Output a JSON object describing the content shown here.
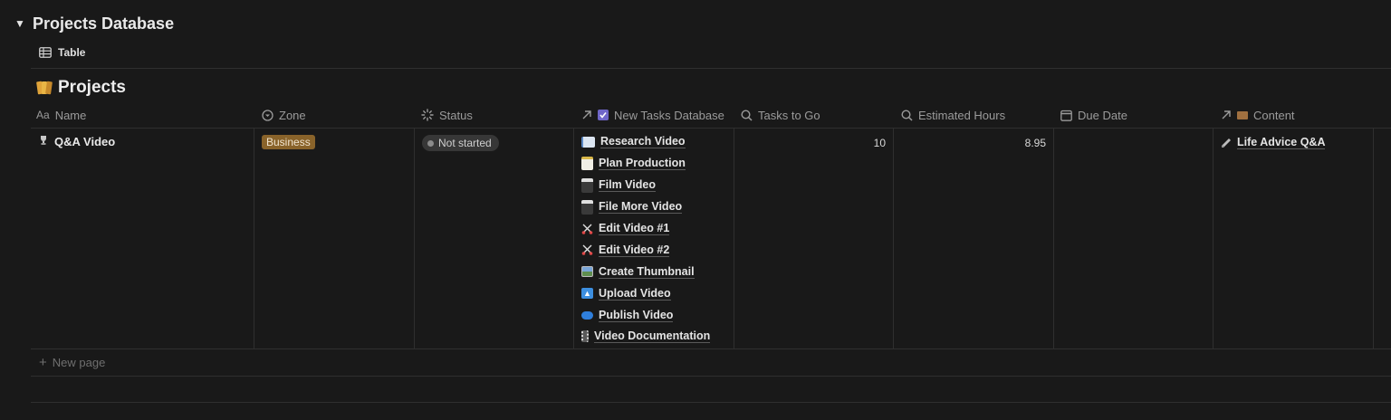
{
  "database": {
    "title": "Projects Database",
    "toggle_icon": "triangle-down-icon"
  },
  "view": {
    "label": "Table",
    "icon": "table-icon"
  },
  "projects_title": {
    "label": "Projects",
    "icon": "books-icon"
  },
  "columns": [
    {
      "label": "Name",
      "icon": "text-aa-icon"
    },
    {
      "label": "Zone",
      "icon": "select-icon"
    },
    {
      "label": "Status",
      "icon": "status-icon"
    },
    {
      "label": "New Tasks Database",
      "icon": "relation-arrow-icon"
    },
    {
      "label": "Tasks to Go",
      "icon": "search-icon"
    },
    {
      "label": "Estimated Hours",
      "icon": "search-icon"
    },
    {
      "label": "Due Date",
      "icon": "calendar-icon"
    },
    {
      "label": "Content",
      "icon": "relation-arrow-icon"
    }
  ],
  "row": {
    "name": "Q&A Video",
    "zone": "Business",
    "status": "Not started",
    "tasks": [
      {
        "label": "Research Video",
        "icon": "book-icon"
      },
      {
        "label": "Plan Production",
        "icon": "memo-icon"
      },
      {
        "label": "Film Video",
        "icon": "clapper-icon"
      },
      {
        "label": "File More Video",
        "icon": "clapper-icon"
      },
      {
        "label": "Edit Video #1",
        "icon": "scissors-icon"
      },
      {
        "label": "Edit Video #2",
        "icon": "scissors-icon"
      },
      {
        "label": "Create Thumbnail",
        "icon": "picture-icon"
      },
      {
        "label": "Upload Video",
        "icon": "up-arrow-icon"
      },
      {
        "label": "Publish Video",
        "icon": "blue-circle-icon"
      },
      {
        "label": "Video Documentation",
        "icon": "film-strip-icon"
      }
    ],
    "tasks_to_go": "10",
    "estimated_hours": "8.95",
    "due_date": "",
    "content": "Life Advice Q&A"
  },
  "new_page": {
    "label": "New page",
    "icon": "plus-icon"
  },
  "colors": {
    "background": "#191919",
    "zone_business": "#89632a",
    "status_pill": "#373737",
    "border": "#2f2f2f"
  }
}
